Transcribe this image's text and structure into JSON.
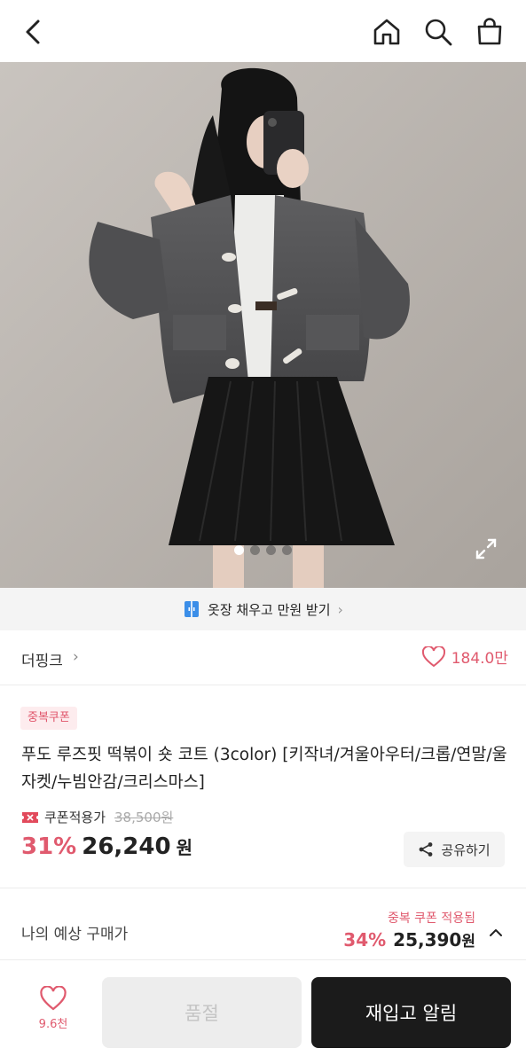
{
  "header": {
    "icons": [
      "chevron-left-icon",
      "home-icon",
      "search-icon",
      "shopping-bag-icon"
    ]
  },
  "gallery": {
    "image_count": 4,
    "active_index": 0
  },
  "promo_banner": {
    "text": "옷장 채우고 만원 받기"
  },
  "brand": {
    "name": "더핑크",
    "like_count": "184.0만"
  },
  "product": {
    "badge": "중복쿠폰",
    "title": "푸도 루즈핏 떡볶이 숏 코트 (3color) [키작녀/겨울아우터/크롭/연말/울자켓/누빔안감/크리스마스]",
    "coupon_label": "쿠폰적용가",
    "original_price": "38,500원",
    "discount": "31%",
    "price": "26,240",
    "currency": "원",
    "share_label": "공유하기"
  },
  "expected_price": {
    "label": "나의 예상 구매가",
    "applied_note": "중복 쿠폰 적용됨",
    "discount": "34%",
    "price": "25,390",
    "currency": "원"
  },
  "bottom_bar": {
    "wish_count": "9.6천",
    "soldout_label": "품절",
    "restock_label": "재입고 알림"
  },
  "colors": {
    "accent": "#e05a6e",
    "dark_button": "#1b1b1b",
    "disabled_button": "#ededed"
  }
}
